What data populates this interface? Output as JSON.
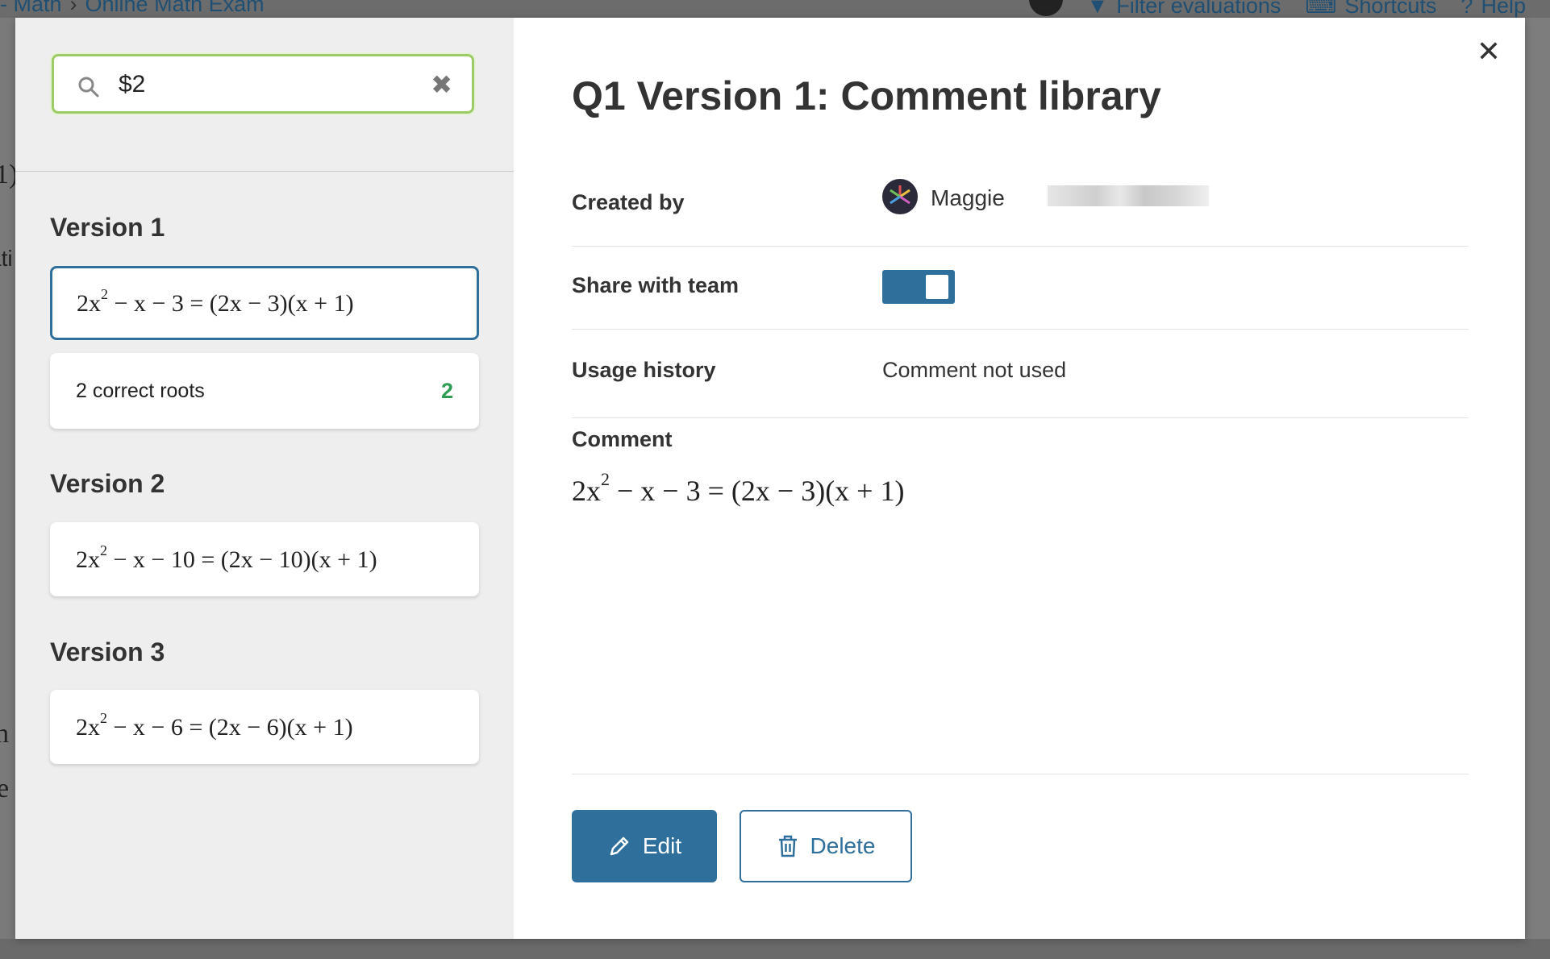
{
  "background": {
    "breadcrumb": [
      "- Math",
      "Online Math Exam"
    ],
    "toolbar": {
      "filter_label": "Filter evaluations",
      "shortcuts_label": "Shortcuts",
      "help_label": "Help"
    },
    "fragments": [
      "1)",
      "ati",
      "h",
      "e"
    ]
  },
  "sidebar": {
    "search": {
      "value": "$2"
    },
    "groups": [
      {
        "title": "Version 1"
      },
      {
        "title": "Version 2"
      },
      {
        "title": "Version 3"
      }
    ],
    "cards": {
      "v1_c1": {
        "pre": "2x",
        "sup": "2",
        "post": " − x − 3 = (2x − 3)(x + 1)"
      },
      "v1_c2": {
        "text": "2 correct roots",
        "count": "2"
      },
      "v2_c1": {
        "pre": "2x",
        "sup": "2",
        "post": " − x − 10 = (2x − 10)(x + 1)"
      },
      "v3_c1": {
        "pre": "2x",
        "sup": "2",
        "post": " − x − 6 = (2x − 6)(x + 1)"
      }
    }
  },
  "detail": {
    "title": "Q1 Version 1: Comment library",
    "created_by_label": "Created by",
    "creator_name": "Maggie",
    "share_label": "Share with team",
    "share_enabled": true,
    "usage_label": "Usage history",
    "usage_value": "Comment not used",
    "comment_label": "Comment",
    "comment": {
      "pre": "2x",
      "sup": "2",
      "post": " − x − 3 = (2x − 3)(x + 1)"
    },
    "edit_label": "Edit",
    "delete_label": "Delete"
  },
  "colors": {
    "accent": "#2e6f9c",
    "search_border": "#9ccc65",
    "count_green": "#2e9d55"
  }
}
